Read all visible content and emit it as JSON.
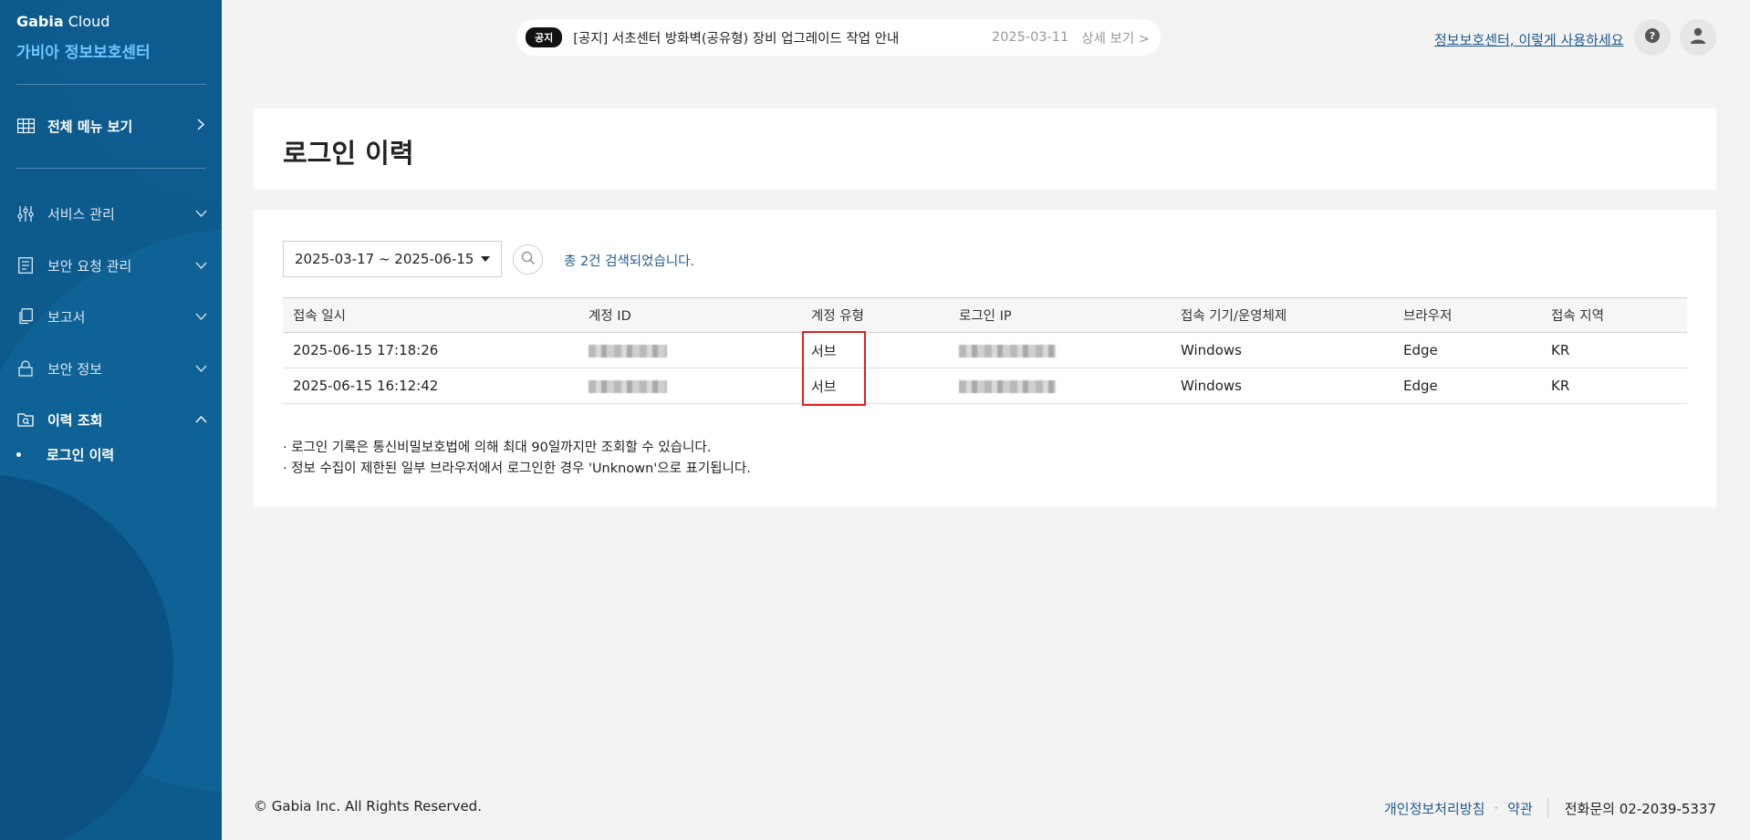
{
  "sidebar": {
    "brand_bold": "Gabia",
    "brand_rest": " Cloud",
    "subtitle": "가비아 정보보호센터",
    "all_menu": "전체 메뉴 보기",
    "items": [
      {
        "label": "서비스 관리"
      },
      {
        "label": "보안 요청 관리"
      },
      {
        "label": "보고서"
      },
      {
        "label": "보안 정보"
      },
      {
        "label": "이력 조회"
      }
    ],
    "sub_item": "로그인 이력"
  },
  "notice": {
    "badge": "공지",
    "text": "[공지] 서초센터 방화벽(공유형) 장비 업그레이드 작업 안내",
    "date": "2025-03-11",
    "more": "상세 보기 >"
  },
  "header": {
    "help_link": "정보보호센터, 이렇게 사용하세요"
  },
  "page": {
    "title": "로그인 이력",
    "date_range": "2025-03-17 ~ 2025-06-15",
    "result_count": "총 2건 검색되었습니다."
  },
  "table": {
    "headers": [
      "접속 일시",
      "계정 ID",
      "계정 유형",
      "로그인 IP",
      "접속 기기/운영체제",
      "브라우저",
      "접속 지역"
    ],
    "rows": [
      {
        "datetime": "2025-06-15 17:18:26",
        "account_type": "서브",
        "os": "Windows",
        "browser": "Edge",
        "region": "KR"
      },
      {
        "datetime": "2025-06-15 16:12:42",
        "account_type": "서브",
        "os": "Windows",
        "browser": "Edge",
        "region": "KR"
      }
    ]
  },
  "notes": [
    "· 로그인 기록은 통신비밀보호법에 의해 최대 90일까지만 조회할 수 있습니다.",
    "· 정보 수집이 제한된 일부 브라우저에서 로그인한 경우 'Unknown'으로 표기됩니다."
  ],
  "footer": {
    "copyright": "© Gabia Inc. All Rights Reserved.",
    "privacy": "개인정보처리방침",
    "separator": "·",
    "terms": "약관",
    "phone": "전화문의 02-2039-5337"
  },
  "colors": {
    "sidebar_bg": "#0d5a8c",
    "accent_blue": "#6cc6ff",
    "link_blue": "#1f5a8c",
    "highlight_red": "#e02020"
  }
}
